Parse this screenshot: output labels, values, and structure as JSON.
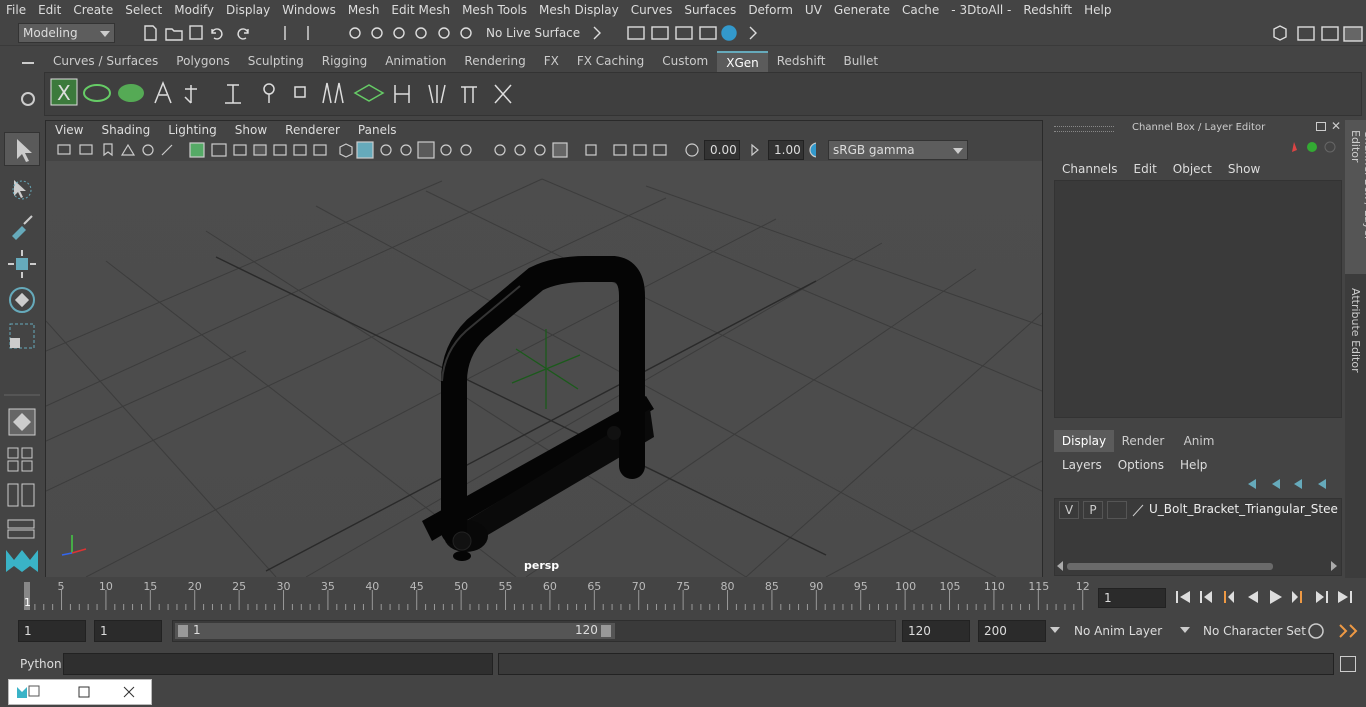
{
  "menubar": {
    "items": [
      "File",
      "Edit",
      "Create",
      "Select",
      "Modify",
      "Display",
      "Windows",
      "Mesh",
      "Edit Mesh",
      "Mesh Tools",
      "Mesh Display",
      "Curves",
      "Surfaces",
      "Deform",
      "UV",
      "Generate",
      "Cache",
      "- 3DtoAll -",
      "Redshift",
      "Help"
    ]
  },
  "statusline": {
    "mode": "Modeling",
    "live_surface": "No Live Surface"
  },
  "shelf": {
    "tabs": [
      "Curves / Surfaces",
      "Polygons",
      "Sculpting",
      "Rigging",
      "Animation",
      "Rendering",
      "FX",
      "FX Caching",
      "Custom",
      "XGen",
      "Redshift",
      "Bullet"
    ],
    "active_tab": "XGen"
  },
  "viewport": {
    "menu": [
      "View",
      "Shading",
      "Lighting",
      "Show",
      "Renderer",
      "Panels"
    ],
    "exposure": "0.00",
    "gamma": "1.00",
    "color_space": "sRGB gamma",
    "camera_label": "persp"
  },
  "channel_box": {
    "title": "Channel Box / Layer Editor",
    "menu": [
      "Channels",
      "Edit",
      "Object",
      "Show"
    ],
    "layer_tabs": [
      "Display",
      "Render",
      "Anim"
    ],
    "active_layer_tab": "Display",
    "layer_menu": [
      "Layers",
      "Options",
      "Help"
    ],
    "layer": {
      "v": "V",
      "p": "P",
      "name": "U_Bolt_Bracket_Triangular_Steel_layer"
    },
    "side_tabs": [
      "Channel Box / Layer Editor",
      "Attribute Editor"
    ]
  },
  "timeline": {
    "ticks": [
      "5",
      "10",
      "15",
      "20",
      "25",
      "30",
      "35",
      "40",
      "45",
      "50",
      "55",
      "60",
      "65",
      "70",
      "75",
      "80",
      "85",
      "90",
      "95",
      "100",
      "105",
      "110",
      "115",
      "12"
    ],
    "current_marker": "1",
    "current_frame": "1"
  },
  "range": {
    "start": "1",
    "start2": "1",
    "slider_start": "1",
    "slider_end": "120",
    "end": "120",
    "end2": "200",
    "anim_layer": "No Anim Layer",
    "character_set": "No Character Set"
  },
  "command": {
    "language": "Python"
  }
}
